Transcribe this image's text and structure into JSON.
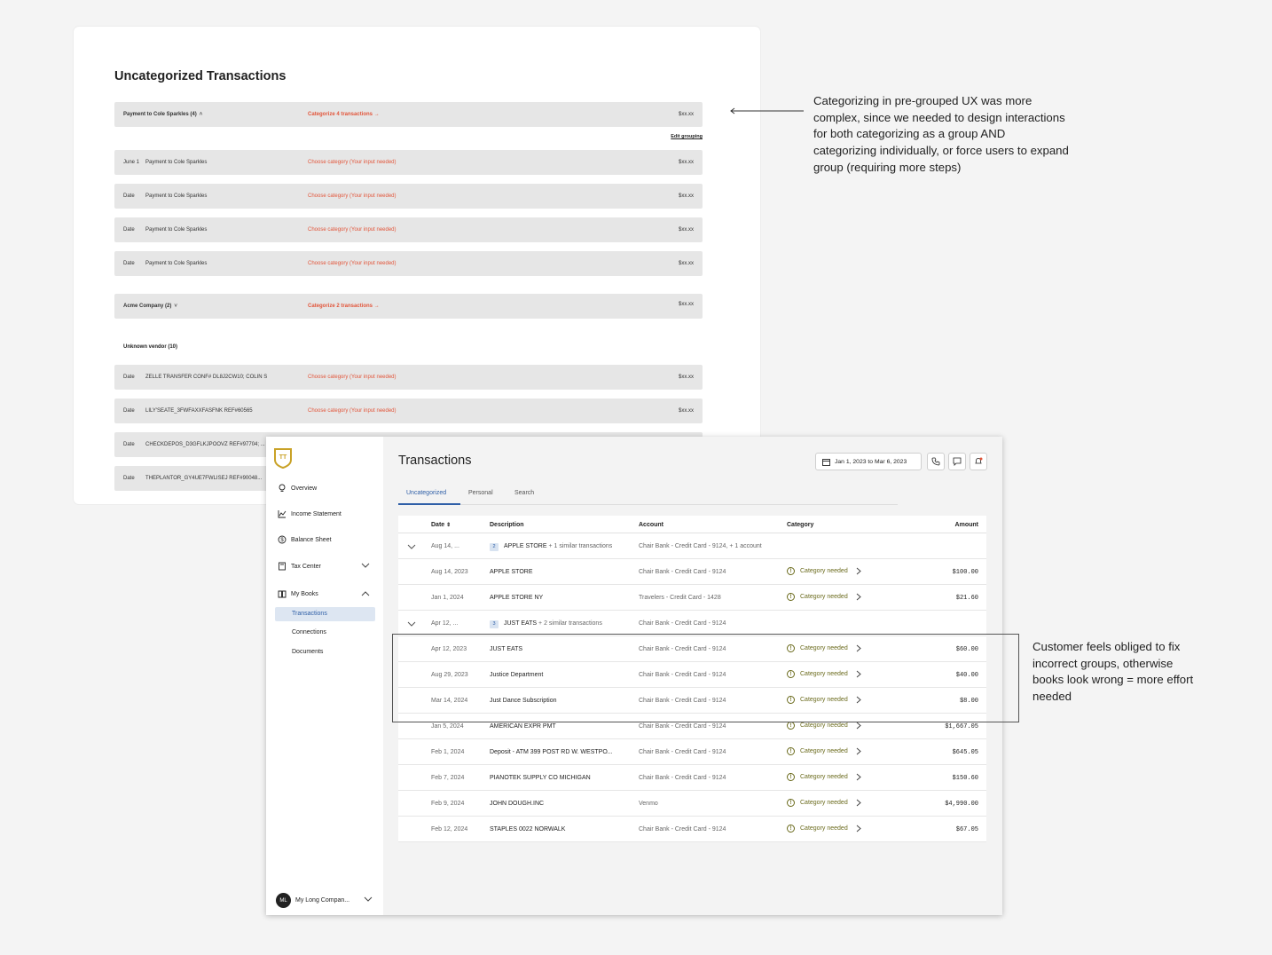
{
  "wireframe": {
    "title": "Uncategorized Transactions",
    "edit_grouping": "Edit grouping",
    "groups": [
      {
        "label": "Payment to Cole Sparkles (4)",
        "action": "Categorize 4 transactions →",
        "amount": "$xx.xx",
        "chevron": "˄"
      },
      {
        "label": "Acme Company (2)",
        "action": "Categorize 2 transactions →",
        "amount": "$xx.xx",
        "chevron": "˅"
      }
    ],
    "group_rows": [
      {
        "date": "June 1",
        "desc": "Payment to Cole Sparkles",
        "action": "Choose category (Your input needed)",
        "amount": "$xx.xx"
      },
      {
        "date": "Date",
        "desc": "Payment to Cole Sparkles",
        "action": "Choose category (Your input needed)",
        "amount": "$xx.xx"
      },
      {
        "date": "Date",
        "desc": "Payment to Cole Sparkles",
        "action": "Choose category (Your input needed)",
        "amount": "$xx.xx"
      },
      {
        "date": "Date",
        "desc": "Payment to Cole Sparkles",
        "action": "Choose category (Your input needed)",
        "amount": "$xx.xx"
      }
    ],
    "unknown_vendor_label": "Unknown vendor (10)",
    "unknown_rows": [
      {
        "date": "Date",
        "desc": "ZELLE TRANSFER CONF# DL8J2CW10; COLIN S",
        "action": "Choose category (Your input needed)",
        "amount": "$xx.xx"
      },
      {
        "date": "Date",
        "desc": "LILY'SEATE_3FWFAXXFASFNK REF#60565",
        "action": "Choose category (Your input needed)",
        "amount": "$xx.xx"
      },
      {
        "date": "Date",
        "desc": "CHECKDEPOS_D3GFLKJPOOVZ REF#97704; ...",
        "action": "",
        "amount": ""
      },
      {
        "date": "Date",
        "desc": "THEPLANTOR_GY4UE7FWLISEJ REF#90048...",
        "action": "",
        "amount": ""
      }
    ]
  },
  "annotations": {
    "note1": "Categorizing in pre-grouped UX was more complex, since we needed to design interactions for both categorizing as a group AND categorizing individually, or force users to expand group (requiring more steps)",
    "note2": "Customer feels obliged to fix incorrect groups, otherwise books look wrong = more effort needed"
  },
  "app": {
    "sidebar": {
      "items": [
        {
          "label": "Overview",
          "icon": "lightbulb-icon"
        },
        {
          "label": "Income Statement",
          "icon": "chart-line-icon"
        },
        {
          "label": "Balance Sheet",
          "icon": "dollar-circle-icon"
        },
        {
          "label": "Tax Center",
          "icon": "calculator-icon"
        },
        {
          "label": "My Books",
          "icon": "book-icon"
        }
      ],
      "sub_items": [
        "Transactions",
        "Connections",
        "Documents"
      ],
      "user": {
        "initials": "ML",
        "name": "My Long Compan..."
      }
    },
    "title": "Transactions",
    "date_range": "Jan 1, 2023 to Mar 6, 2023",
    "tabs": [
      "Uncategorized",
      "Personal",
      "Search"
    ],
    "columns": {
      "date": "Date",
      "description": "Description",
      "account": "Account",
      "category": "Category",
      "amount": "Amount"
    },
    "rows": [
      {
        "type": "group",
        "date": "Aug 14, ...",
        "count": "2",
        "desc": "APPLE STORE",
        "extra": "+ 1 similar transactions",
        "account": "Chair Bank - Credit Card - 9124, + 1 account"
      },
      {
        "type": "row",
        "date": "Aug 14, 2023",
        "desc": "APPLE STORE",
        "account": "Chair Bank - Credit Card - 9124",
        "category": "Category needed",
        "amount": "$100.00"
      },
      {
        "type": "row",
        "date": "Jan 1, 2024",
        "desc": "APPLE STORE NY",
        "account": "Travelers - Credit Card - 1428",
        "category": "Category needed",
        "amount": "$21.60"
      },
      {
        "type": "group",
        "date": "Apr 12, ...",
        "count": "3",
        "desc": "JUST EATS",
        "extra": "+ 2 similar transactions",
        "account": "Chair Bank - Credit Card - 9124"
      },
      {
        "type": "row",
        "date": "Apr 12, 2023",
        "desc": "JUST EATS",
        "account": "Chair Bank - Credit Card - 9124",
        "category": "Category needed",
        "amount": "$60.00"
      },
      {
        "type": "row",
        "date": "Aug 29, 2023",
        "desc": "Justice Department",
        "account": "Chair Bank - Credit Card - 9124",
        "category": "Category needed",
        "amount": "$40.00"
      },
      {
        "type": "row",
        "date": "Mar 14, 2024",
        "desc": "Just Dance Subscription",
        "account": "Chair Bank - Credit Card - 9124",
        "category": "Category needed",
        "amount": "$8.00"
      },
      {
        "type": "row",
        "date": "Jan 5, 2024",
        "desc": "AMERICAN EXPR PMT",
        "account": "Chair Bank - Credit Card - 9124",
        "category": "Category needed",
        "amount": "$1,667.05"
      },
      {
        "type": "row",
        "date": "Feb 1, 2024",
        "desc": "Deposit - ATM 399 POST RD W. WESTPO...",
        "account": "Chair Bank - Credit Card - 9124",
        "category": "Category needed",
        "amount": "$645.05"
      },
      {
        "type": "row",
        "date": "Feb 7, 2024",
        "desc": "PIANOTEK SUPPLY CO MICHIGAN",
        "account": "Chair Bank - Credit Card - 9124",
        "category": "Category needed",
        "amount": "$150.60"
      },
      {
        "type": "row",
        "date": "Feb 9, 2024",
        "desc": "JOHN DOUGH.INC",
        "account": "Venmo",
        "category": "Category needed",
        "amount": "$4,990.00"
      },
      {
        "type": "row",
        "date": "Feb 12, 2024",
        "desc": "STAPLES 0022 NORWALK",
        "account": "Chair Bank - Credit Card - 9124",
        "category": "Category needed",
        "amount": "$67.05"
      }
    ]
  },
  "colors": {
    "accent": "#2f5fa7",
    "warning_text": "#e2553a",
    "category_needed": "#6b6b1d",
    "logo": "#c9a227"
  }
}
